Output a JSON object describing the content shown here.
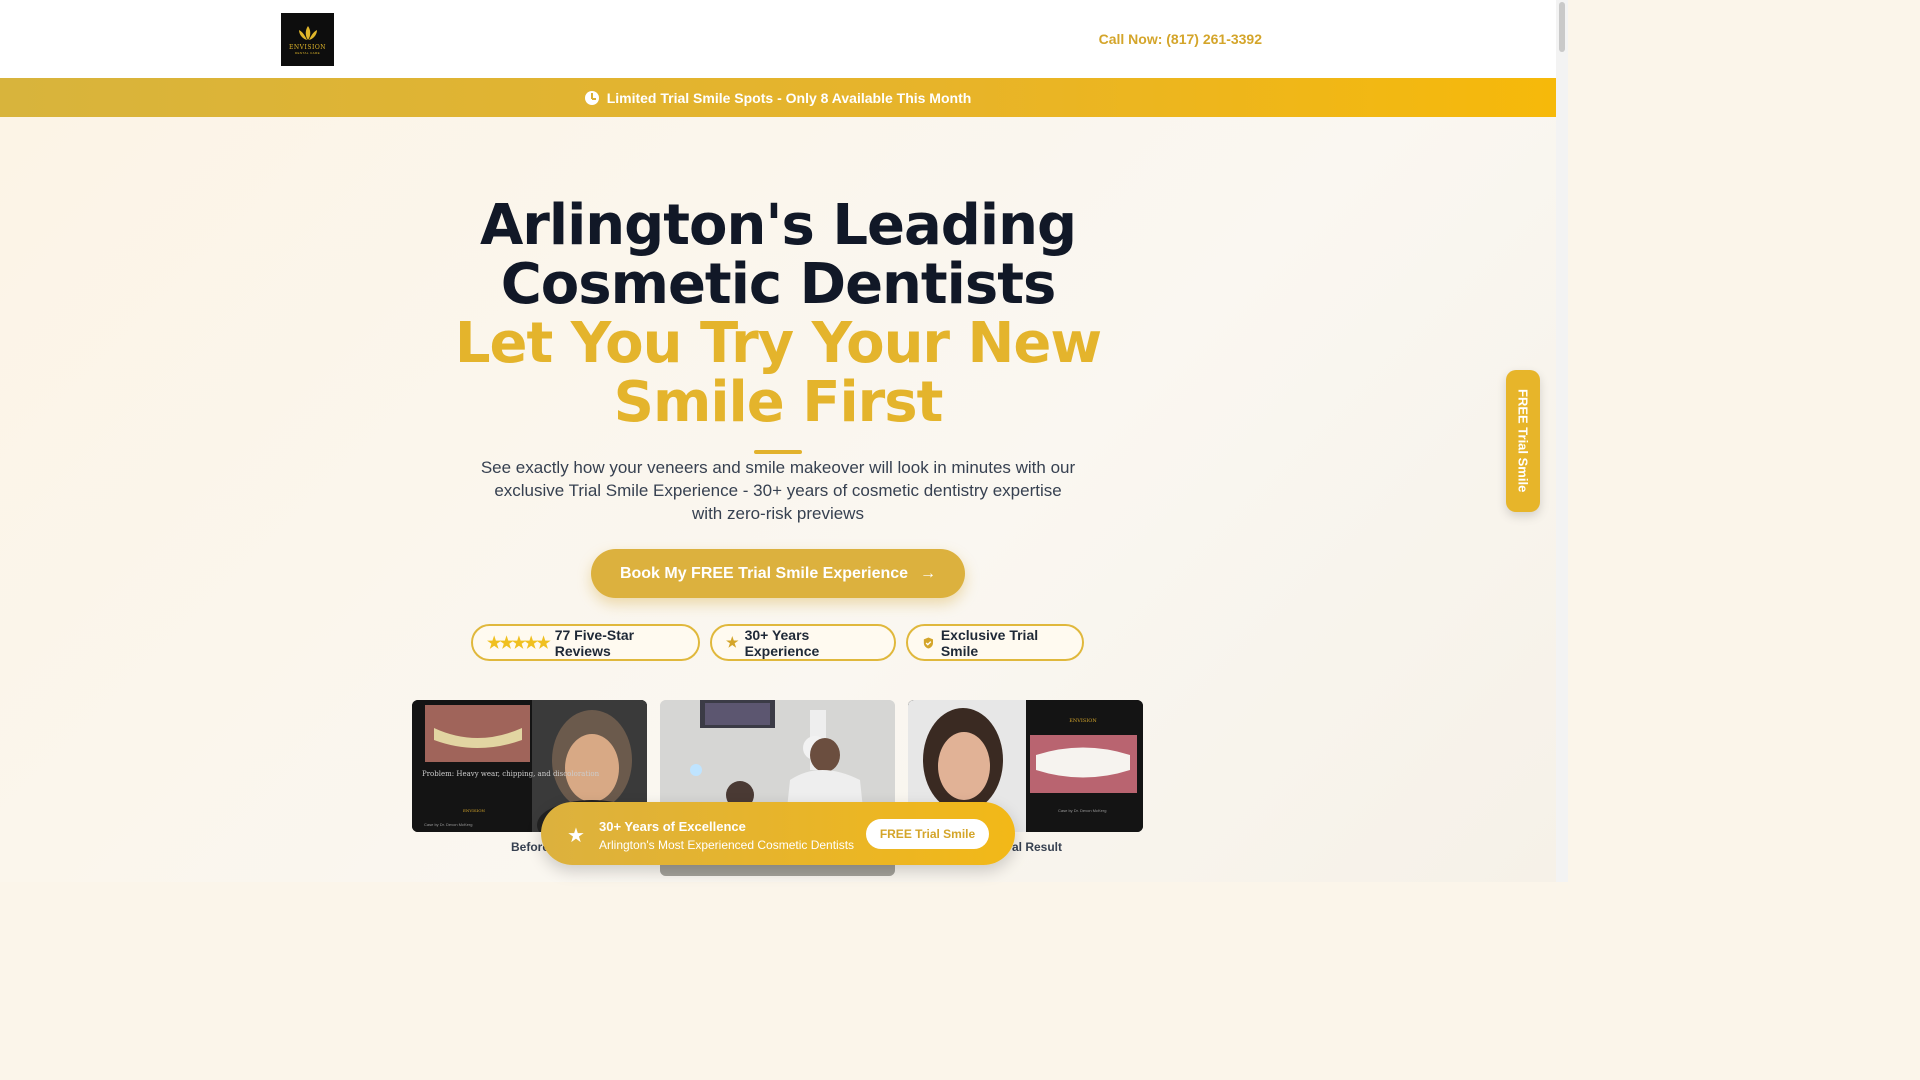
{
  "header": {
    "logo_text": "ENVISION",
    "logo_sub": "DENTAL CARE",
    "call_label": "Call Now: (817) 261-3392"
  },
  "banner": {
    "icon": "clock-icon",
    "text": "Limited Trial Smile Spots - Only 8 Available This Month"
  },
  "hero": {
    "title_line1": "Arlington's Leading",
    "title_line2": "Cosmetic Dentists",
    "title_line3": "Let You Try Your New",
    "title_line4": "Smile First",
    "subtitle": "See exactly how your veneers and smile makeover will look in minutes with our exclusive Trial Smile Experience - 30+ years of cosmetic dentistry expertise with zero-risk previews",
    "cta_label": "Book My FREE Trial Smile Experience",
    "cta_arrow": "→"
  },
  "badges": [
    {
      "icon": "five-stars-icon",
      "label": "77 Five-Star Reviews"
    },
    {
      "icon": "star-icon",
      "label": "30+ Years Experience"
    },
    {
      "icon": "shield-check-icon",
      "label": "Exclusive Trial Smile"
    }
  ],
  "gallery": {
    "card1_text": "Problem: Heavy wear, chipping, and discoloration",
    "card1_case": "Case by Dr. Devon McKerg",
    "card3_case": "Case by Dr. Devon McKerg",
    "caption_left": "Before",
    "caption_right": "al Result"
  },
  "sticky": {
    "title": "30+ Years of Excellence",
    "subtitle": "Arlington's Most Experienced Cosmetic Dentists",
    "button": "FREE Trial Smile"
  },
  "side_tab": {
    "label": "FREE Trial Smile"
  },
  "colors": {
    "gold": "#e4b42c",
    "dark": "#111827",
    "banner_start": "#d8b43c",
    "banner_end": "#f6b90a"
  }
}
